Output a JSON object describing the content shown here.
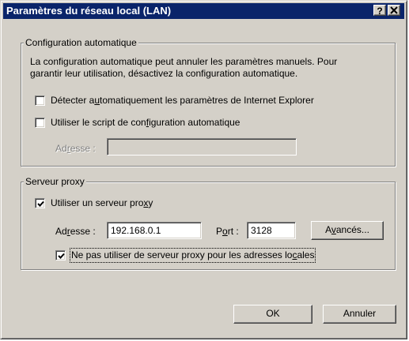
{
  "window": {
    "title": "Paramètres du réseau local (LAN)",
    "help_label": "?",
    "close_label": "✕"
  },
  "auto_config": {
    "legend": "Configuration automatique",
    "description_line1": "La configuration automatique peut annuler les paramètres manuels. Pour",
    "description_line2": "garantir leur utilisation, désactivez la configuration automatique.",
    "detect": {
      "pre": "Détecter a",
      "mn": "u",
      "post": "tomatiquement les paramètres de Internet Explorer",
      "checked": false
    },
    "script": {
      "pre": "Utiliser le script de con",
      "mn": "f",
      "post": "iguration automatique",
      "checked": false
    },
    "address_label": {
      "pre": "Ad",
      "mn": "r",
      "post": "esse :"
    },
    "address_value": ""
  },
  "proxy": {
    "legend": "Serveur proxy",
    "use_proxy": {
      "pre": "Utiliser un serveur pro",
      "mn": "x",
      "post": "y",
      "checked": true
    },
    "address_label": {
      "pre": "Ad",
      "mn": "r",
      "post": "esse :"
    },
    "address_value": "192.168.0.1",
    "port_label": {
      "pre": "P",
      "mn": "o",
      "post": "rt :"
    },
    "port_value": "3128",
    "advanced": {
      "pre": "A",
      "mn": "v",
      "post": "ancés..."
    },
    "bypass_local": {
      "pre": "Ne pas utiliser de serveur proxy pour les adresses lo",
      "mn": "c",
      "post": "ales",
      "checked": true
    }
  },
  "footer": {
    "ok_label": "OK",
    "cancel_label": "Annuler"
  },
  "colors": {
    "titlebar": "#0a246a",
    "face": "#d4d0c8"
  }
}
